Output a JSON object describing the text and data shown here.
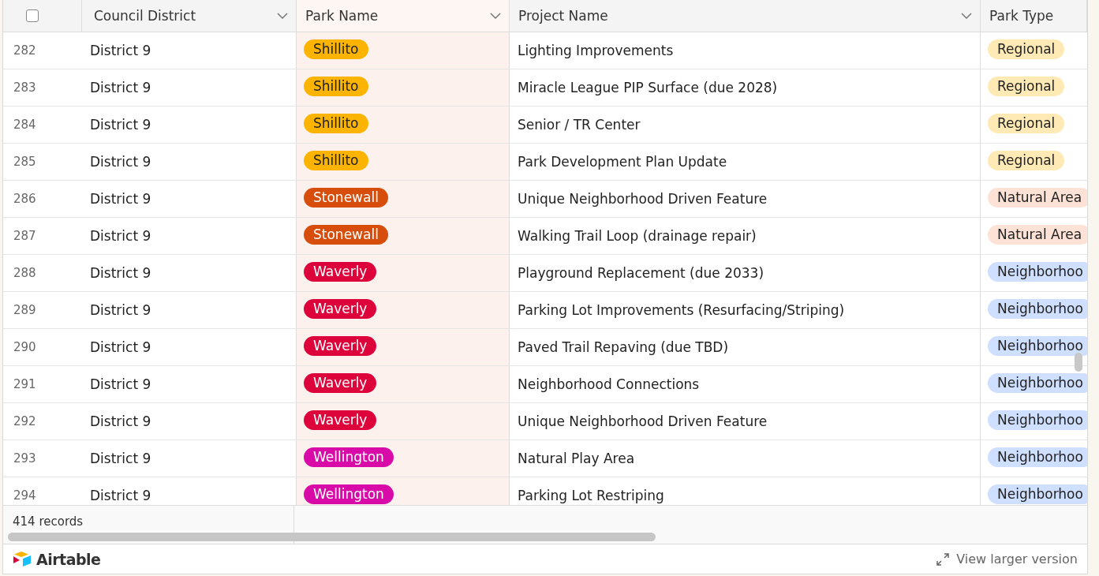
{
  "table": {
    "select_all": {
      "checked": false
    },
    "columns": [
      {
        "label": "Council District",
        "menu": true
      },
      {
        "label": "Park Name",
        "menu": true
      },
      {
        "label": "Project Name",
        "menu": true
      },
      {
        "label": "Park Type",
        "menu": false
      }
    ],
    "rows": [
      {
        "number": "282",
        "district": "District 9",
        "park": {
          "label": "Shillito",
          "color": "#fcb400"
        },
        "project": "Lighting Improvements",
        "type": {
          "label": "Regional",
          "color": "#ffeab6"
        }
      },
      {
        "number": "283",
        "district": "District 9",
        "park": {
          "label": "Shillito",
          "color": "#fcb400"
        },
        "project": "Miracle League PIP Surface (due 2028)",
        "type": {
          "label": "Regional",
          "color": "#ffeab6"
        }
      },
      {
        "number": "284",
        "district": "District 9",
        "park": {
          "label": "Shillito",
          "color": "#fcb400"
        },
        "project": "Senior / TR Center",
        "type": {
          "label": "Regional",
          "color": "#ffeab6"
        }
      },
      {
        "number": "285",
        "district": "District 9",
        "park": {
          "label": "Shillito",
          "color": "#fcb400"
        },
        "project": "Park Development Plan Update",
        "type": {
          "label": "Regional",
          "color": "#ffeab6"
        }
      },
      {
        "number": "286",
        "district": "District 9",
        "park": {
          "label": "Stonewall",
          "color": "#d74d0b"
        },
        "project": "Unique Neighborhood Driven Feature",
        "type": {
          "label": "Natural Area",
          "color": "#fee2d5"
        }
      },
      {
        "number": "287",
        "district": "District 9",
        "park": {
          "label": "Stonewall",
          "color": "#d74d0b"
        },
        "project": "Walking Trail Loop (drainage repair)",
        "type": {
          "label": "Natural Area",
          "color": "#fee2d5"
        }
      },
      {
        "number": "288",
        "district": "District 9",
        "park": {
          "label": "Waverly",
          "color": "#dc043b"
        },
        "project": "Playground Replacement (due 2033)",
        "type": {
          "label": "Neighborhoo",
          "color": "#cfdfff"
        }
      },
      {
        "number": "289",
        "district": "District 9",
        "park": {
          "label": "Waverly",
          "color": "#dc043b"
        },
        "project": "Parking Lot Improvements (Resurfacing/Striping)",
        "type": {
          "label": "Neighborhoo",
          "color": "#cfdfff"
        }
      },
      {
        "number": "290",
        "district": "District 9",
        "park": {
          "label": "Waverly",
          "color": "#dc043b"
        },
        "project": "Paved Trail Repaving (due TBD)",
        "type": {
          "label": "Neighborhoo",
          "color": "#cfdfff"
        }
      },
      {
        "number": "291",
        "district": "District 9",
        "park": {
          "label": "Waverly",
          "color": "#dc043b"
        },
        "project": "Neighborhood Connections",
        "type": {
          "label": "Neighborhoo",
          "color": "#cfdfff"
        }
      },
      {
        "number": "292",
        "district": "District 9",
        "park": {
          "label": "Waverly",
          "color": "#dc043b"
        },
        "project": "Unique Neighborhood Driven Feature",
        "type": {
          "label": "Neighborhoo",
          "color": "#cfdfff"
        }
      },
      {
        "number": "293",
        "district": "District 9",
        "park": {
          "label": "Wellington",
          "color": "#d90ba8"
        },
        "project": "Natural Play Area",
        "type": {
          "label": "Neighborhoo",
          "color": "#cfdfff"
        }
      },
      {
        "number": "294",
        "district": "District 9",
        "park": {
          "label": "Wellington",
          "color": "#d90ba8"
        },
        "project": "Parking Lot Restriping",
        "type": {
          "label": "Neighborhoo",
          "color": "#cfdfff"
        }
      }
    ]
  },
  "summary": {
    "records": "414 records"
  },
  "footer": {
    "brand": "Airtable",
    "link": "View larger version"
  }
}
